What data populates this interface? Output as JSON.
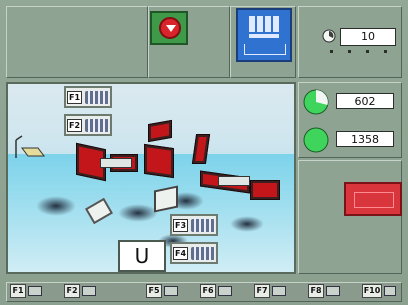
{
  "top": {
    "counter_value": "10"
  },
  "viewport": {
    "f1_label": "F1",
    "f2_label": "F2",
    "f3_label": "F3",
    "f4_label": "F4",
    "axis_letter": "U"
  },
  "right_panel": {
    "value_1": "602",
    "value_2": "1358"
  },
  "fkeys": [
    "F1",
    "F2",
    "F5",
    "F6",
    "F7",
    "F8",
    "F10"
  ],
  "colors": {
    "stop_green": "#3e9a49",
    "stop_red": "#d8242a",
    "doc_blue": "#2f72d0",
    "warn_red": "#d8353d",
    "indicator_green": "#3fd55c"
  }
}
